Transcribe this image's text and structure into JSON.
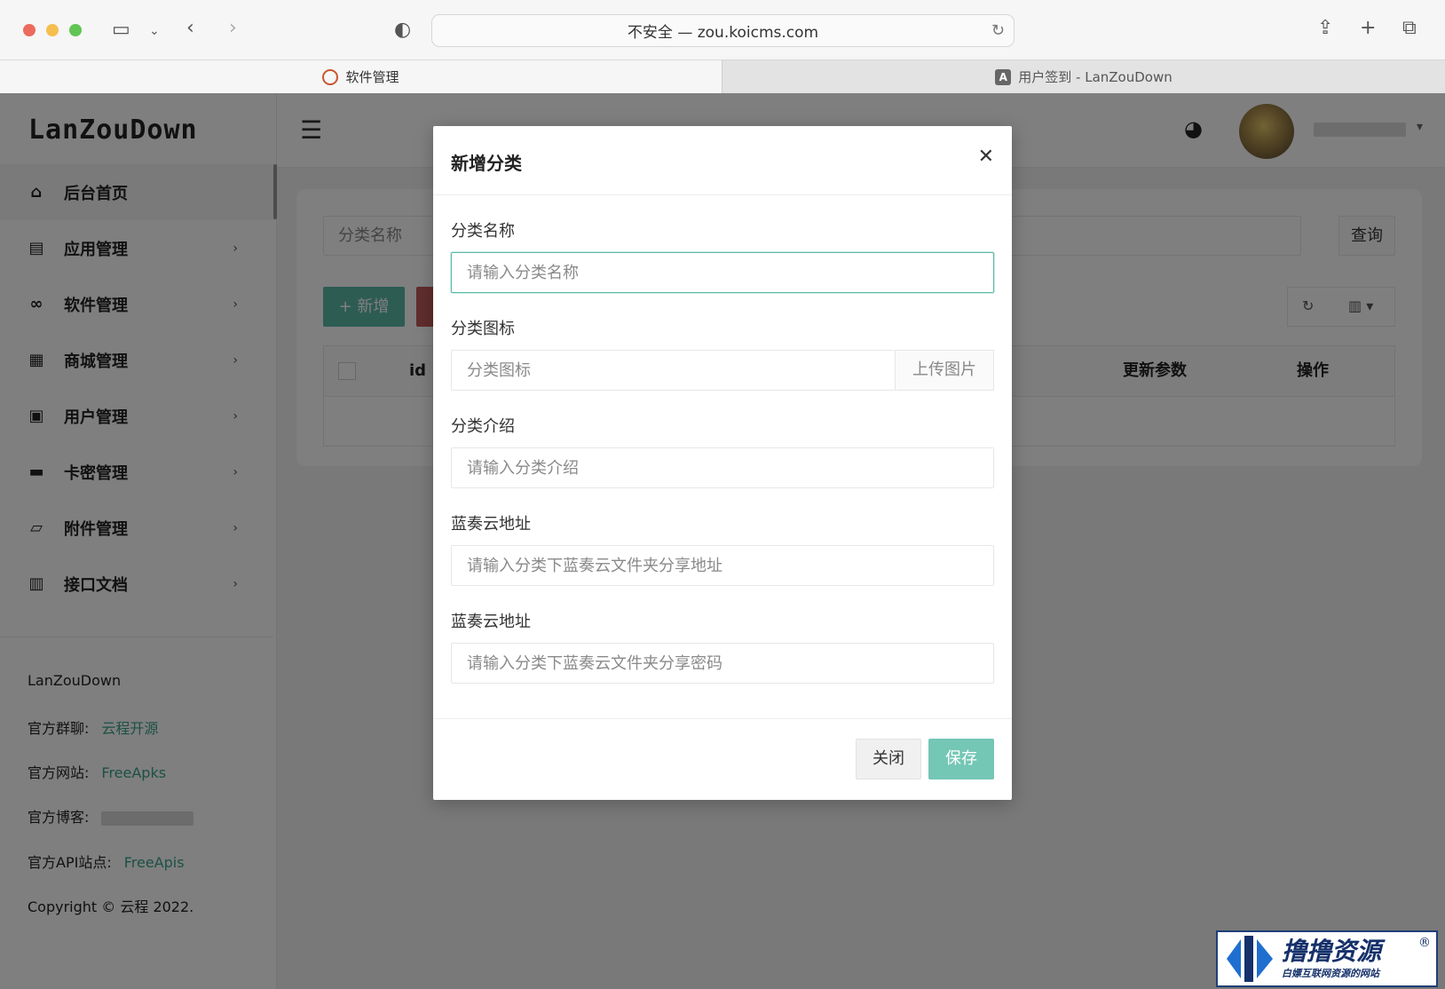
{
  "browser": {
    "address": "不安全 — zou.koicms.com",
    "tabs": [
      {
        "label": "软件管理",
        "active": true
      },
      {
        "label": "用户签到 - LanZouDown",
        "active": false,
        "favicon_letter": "A"
      }
    ]
  },
  "sidebar": {
    "logo": "LanZouDown",
    "items": [
      {
        "label": "后台首页",
        "icon": "home-icon"
      },
      {
        "label": "应用管理",
        "icon": "laptop-icon"
      },
      {
        "label": "软件管理",
        "icon": "infinity-icon"
      },
      {
        "label": "商城管理",
        "icon": "store-icon"
      },
      {
        "label": "用户管理",
        "icon": "id-badge-icon"
      },
      {
        "label": "卡密管理",
        "icon": "credit-card-icon"
      },
      {
        "label": "附件管理",
        "icon": "folder-open-icon"
      },
      {
        "label": "接口文档",
        "icon": "inbox-icon"
      }
    ],
    "info": {
      "name": "LanZouDown",
      "group_label": "官方群聊:",
      "group_link": "云程开源",
      "site_label": "官方网站:",
      "site_link": "FreeApks",
      "blog_label": "官方博客:",
      "api_label": "官方API站点:",
      "api_link": "FreeApis",
      "copyright": "Copyright © 云程 2022."
    }
  },
  "page": {
    "search_placeholder": "分类名称",
    "search_button": "查询",
    "add_button": "+ 新增",
    "columns": [
      "id",
      "更新参数",
      "操作"
    ]
  },
  "modal": {
    "title": "新增分类",
    "fields": {
      "name": {
        "label": "分类名称",
        "placeholder": "请输入分类名称"
      },
      "icon": {
        "label": "分类图标",
        "placeholder": "分类图标",
        "upload": "上传图片"
      },
      "intro": {
        "label": "分类介绍",
        "placeholder": "请输入分类介绍"
      },
      "lanzou_url": {
        "label": "蓝奏云地址",
        "placeholder": "请输入分类下蓝奏云文件夹分享地址"
      },
      "lanzou_pwd": {
        "label": "蓝奏云地址",
        "placeholder": "请输入分类下蓝奏云文件夹分享密码"
      }
    },
    "close_button": "关闭",
    "save_button": "保存"
  },
  "watermark": {
    "main": "撸撸资源",
    "sub": "白嫖互联网资源的网站",
    "reg": "®"
  },
  "colors": {
    "accent": "#5bb8a6",
    "save": "#74c6b5",
    "overlay": "rgba(0,0,0,0.5)"
  }
}
